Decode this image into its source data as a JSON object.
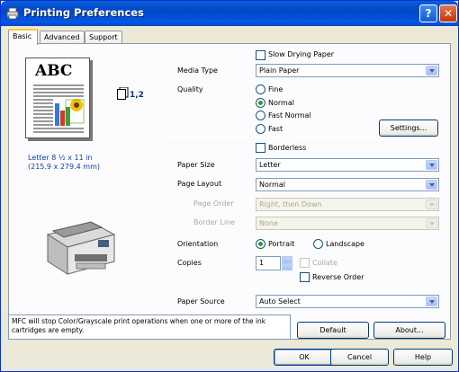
{
  "window": {
    "title": "Printing Preferences"
  },
  "tabs": [
    {
      "label": "Basic"
    },
    {
      "label": "Advanced"
    },
    {
      "label": "Support"
    }
  ],
  "preview": {
    "page_heading": "ABC",
    "copies_indicator": "1,2",
    "paper_line1": "Letter 8 ½ x 11 in",
    "paper_line2": "(215.9 x 279.4 mm)"
  },
  "slow_drying": {
    "label": "Slow Drying Paper",
    "checked": false
  },
  "media_type": {
    "label": "Media Type",
    "value": "Plain Paper"
  },
  "quality": {
    "label": "Quality",
    "options": [
      "Fine",
      "Normal",
      "Fast Normal",
      "Fast"
    ],
    "selected": "Normal",
    "settings_button": "Settings..."
  },
  "borderless": {
    "label": "Borderless",
    "checked": false
  },
  "paper_size": {
    "label": "Paper Size",
    "value": "Letter"
  },
  "page_layout": {
    "label": "Page Layout",
    "value": "Normal"
  },
  "page_order": {
    "label": "Page Order",
    "value": "Right, then Down"
  },
  "border_line": {
    "label": "Border Line",
    "value": "None"
  },
  "orientation": {
    "label": "Orientation",
    "options": [
      "Portrait",
      "Landscape"
    ],
    "selected": "Portrait"
  },
  "copies": {
    "label": "Copies",
    "value": "1",
    "collate": "Collate",
    "reverse_order": "Reverse Order"
  },
  "paper_source": {
    "label": "Paper Source",
    "value": "Auto Select"
  },
  "status_message": "MFC will stop Color/Grayscale print operations when one or more of the ink cartridges are empty.",
  "buttons": {
    "default": "Default",
    "about": "About...",
    "ok": "OK",
    "cancel": "Cancel",
    "help": "Help"
  },
  "colors": {
    "titlebar": "#0058e6",
    "accent_tab": "#ffc83c",
    "radio_dot": "#21a121"
  }
}
